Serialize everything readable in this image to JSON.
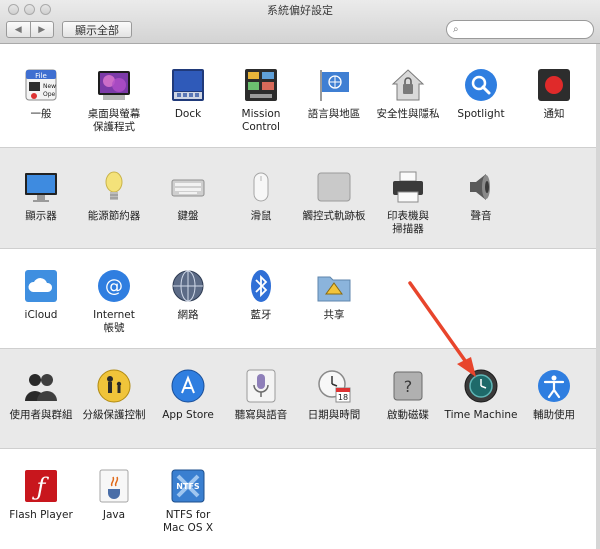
{
  "window": {
    "title": "系統偏好設定",
    "back_glyph": "◀",
    "forward_glyph": "▶",
    "show_all_label": "顯示全部",
    "search_glyph": "⌕"
  },
  "rows": [
    {
      "name": "personal",
      "items": [
        {
          "key": "general",
          "label": "一般",
          "icon": "general-icon"
        },
        {
          "key": "desktop",
          "label": "桌面與螢幕\n保護程式",
          "icon": "desktop-screensaver-icon"
        },
        {
          "key": "dock",
          "label": "Dock",
          "icon": "dock-icon"
        },
        {
          "key": "mission-control",
          "label": "Mission\nControl",
          "icon": "mission-control-icon"
        },
        {
          "key": "language",
          "label": "語言與地區",
          "icon": "flag-icon"
        },
        {
          "key": "security",
          "label": "安全性與隱私",
          "icon": "house-lock-icon"
        },
        {
          "key": "spotlight",
          "label": "Spotlight",
          "icon": "spotlight-icon"
        },
        {
          "key": "notifications",
          "label": "通知",
          "icon": "notifications-icon"
        }
      ]
    },
    {
      "name": "hardware",
      "items": [
        {
          "key": "displays",
          "label": "顯示器",
          "icon": "display-icon"
        },
        {
          "key": "energy",
          "label": "能源節約器",
          "icon": "lightbulb-icon"
        },
        {
          "key": "keyboard",
          "label": "鍵盤",
          "icon": "keyboard-icon"
        },
        {
          "key": "mouse",
          "label": "滑鼠",
          "icon": "mouse-icon"
        },
        {
          "key": "trackpad",
          "label": "觸控式軌跡板",
          "icon": "trackpad-icon"
        },
        {
          "key": "printers",
          "label": "印表機與\n掃描器",
          "icon": "printer-icon"
        },
        {
          "key": "sound",
          "label": "聲音",
          "icon": "speaker-icon"
        }
      ]
    },
    {
      "name": "internet",
      "items": [
        {
          "key": "icloud",
          "label": "iCloud",
          "icon": "icloud-icon"
        },
        {
          "key": "internet-accounts",
          "label": "Internet\n帳號",
          "icon": "at-sign-icon"
        },
        {
          "key": "network",
          "label": "網路",
          "icon": "network-globe-icon"
        },
        {
          "key": "bluetooth",
          "label": "藍牙",
          "icon": "bluetooth-icon"
        },
        {
          "key": "sharing",
          "label": "共享",
          "icon": "sharing-folder-icon"
        }
      ]
    },
    {
      "name": "system",
      "items": [
        {
          "key": "users",
          "label": "使用者與群組",
          "icon": "users-icon"
        },
        {
          "key": "parental",
          "label": "分級保護控制",
          "icon": "parental-controls-icon"
        },
        {
          "key": "app-store",
          "label": "App Store",
          "icon": "app-store-icon"
        },
        {
          "key": "dictation",
          "label": "聽寫與語音",
          "icon": "microphone-icon"
        },
        {
          "key": "date-time",
          "label": "日期與時間",
          "icon": "clock-calendar-icon"
        },
        {
          "key": "startup-disk",
          "label": "啟動磁碟",
          "icon": "disk-icon"
        },
        {
          "key": "time-machine",
          "label": "Time Machine",
          "icon": "time-machine-icon"
        },
        {
          "key": "accessibility",
          "label": "輔助使用",
          "icon": "accessibility-icon"
        }
      ]
    },
    {
      "name": "other",
      "items": [
        {
          "key": "flash",
          "label": "Flash Player",
          "icon": "flash-icon"
        },
        {
          "key": "java",
          "label": "Java",
          "icon": "java-icon"
        },
        {
          "key": "ntfs",
          "label": "NTFS for\nMac OS X",
          "icon": "ntfs-icon"
        }
      ]
    }
  ],
  "icon_text": {
    "general_file": "File",
    "general_new": "New",
    "general_open": "Ope",
    "calendar_day": "18",
    "ntfs_badge": "NTFS",
    "disk_question": "?",
    "flash_glyph": "ƒ",
    "at_glyph": "@"
  },
  "annotation_color": "#e8452c"
}
